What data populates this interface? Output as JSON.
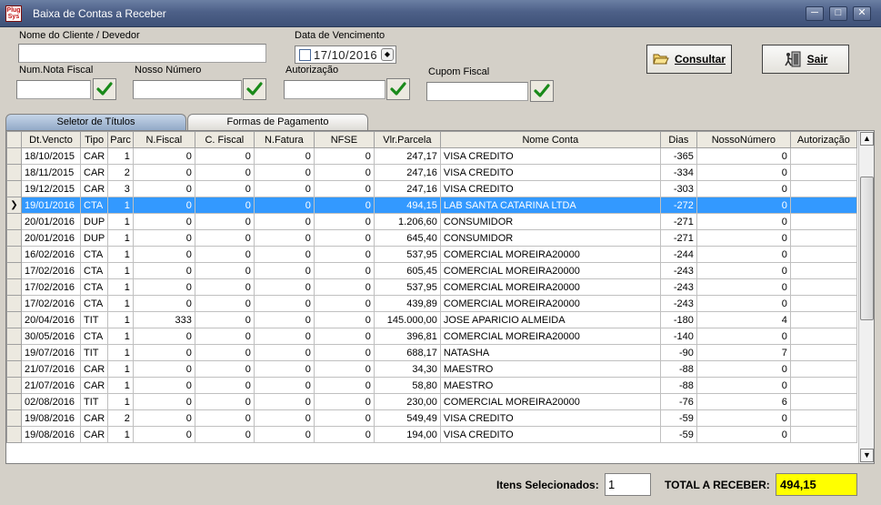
{
  "window": {
    "title": "Baixa de Contas a Receber",
    "app_icon_text": "Plug Sys"
  },
  "form": {
    "cliente_label": "Nome do Cliente / Devedor",
    "cliente_value": "",
    "vencimento_label": "Data de Vencimento",
    "vencimento_value": "17/10/2016",
    "num_nota_label": "Num.Nota Fiscal",
    "nosso_numero_label": "Nosso Número",
    "autorizacao_label": "Autorização",
    "cupom_label": "Cupom Fiscal",
    "consultar_label": "Consultar",
    "sair_label": "Sair"
  },
  "tabs": [
    {
      "label": "Seletor de Títulos",
      "active": true
    },
    {
      "label": "Formas de Pagamento",
      "active": false
    }
  ],
  "grid": {
    "columns": [
      "Dt.Vencto",
      "Tipo",
      "Parc",
      "N.Fiscal",
      "C. Fiscal",
      "N.Fatura",
      "NFSE",
      "Vlr.Parcela",
      "Nome Conta",
      "Dias",
      "NossoNúmero",
      "Autorização"
    ],
    "rows": [
      [
        "18/10/2015",
        "CAR",
        "1",
        "0",
        "0",
        "0",
        "0",
        "247,17",
        "VISA CREDITO",
        "-365",
        "0",
        ""
      ],
      [
        "18/11/2015",
        "CAR",
        "2",
        "0",
        "0",
        "0",
        "0",
        "247,16",
        "VISA CREDITO",
        "-334",
        "0",
        ""
      ],
      [
        "19/12/2015",
        "CAR",
        "3",
        "0",
        "0",
        "0",
        "0",
        "247,16",
        "VISA CREDITO",
        "-303",
        "0",
        ""
      ],
      [
        "19/01/2016",
        "CTA",
        "1",
        "0",
        "0",
        "0",
        "0",
        "494,15",
        "LAB SANTA CATARINA LTDA",
        "-272",
        "0",
        ""
      ],
      [
        "20/01/2016",
        "DUP",
        "1",
        "0",
        "0",
        "0",
        "0",
        "1.206,60",
        "CONSUMIDOR",
        "-271",
        "0",
        ""
      ],
      [
        "20/01/2016",
        "DUP",
        "1",
        "0",
        "0",
        "0",
        "0",
        "645,40",
        "CONSUMIDOR",
        "-271",
        "0",
        ""
      ],
      [
        "16/02/2016",
        "CTA",
        "1",
        "0",
        "0",
        "0",
        "0",
        "537,95",
        "COMERCIAL MOREIRA20000",
        "-244",
        "0",
        ""
      ],
      [
        "17/02/2016",
        "CTA",
        "1",
        "0",
        "0",
        "0",
        "0",
        "605,45",
        "COMERCIAL MOREIRA20000",
        "-243",
        "0",
        ""
      ],
      [
        "17/02/2016",
        "CTA",
        "1",
        "0",
        "0",
        "0",
        "0",
        "537,95",
        "COMERCIAL MOREIRA20000",
        "-243",
        "0",
        ""
      ],
      [
        "17/02/2016",
        "CTA",
        "1",
        "0",
        "0",
        "0",
        "0",
        "439,89",
        "COMERCIAL MOREIRA20000",
        "-243",
        "0",
        ""
      ],
      [
        "20/04/2016",
        "TIT",
        "1",
        "333",
        "0",
        "0",
        "0",
        "145.000,00",
        "JOSE APARICIO ALMEIDA",
        "-180",
        "4",
        ""
      ],
      [
        "30/05/2016",
        "CTA",
        "1",
        "0",
        "0",
        "0",
        "0",
        "396,81",
        "COMERCIAL MOREIRA20000",
        "-140",
        "0",
        ""
      ],
      [
        "19/07/2016",
        "TIT",
        "1",
        "0",
        "0",
        "0",
        "0",
        "688,17",
        "NATASHA",
        "-90",
        "7",
        ""
      ],
      [
        "21/07/2016",
        "CAR",
        "1",
        "0",
        "0",
        "0",
        "0",
        "34,30",
        "MAESTRO",
        "-88",
        "0",
        ""
      ],
      [
        "21/07/2016",
        "CAR",
        "1",
        "0",
        "0",
        "0",
        "0",
        "58,80",
        "MAESTRO",
        "-88",
        "0",
        ""
      ],
      [
        "02/08/2016",
        "TIT",
        "1",
        "0",
        "0",
        "0",
        "0",
        "230,00",
        "COMERCIAL MOREIRA20000",
        "-76",
        "6",
        ""
      ],
      [
        "19/08/2016",
        "CAR",
        "2",
        "0",
        "0",
        "0",
        "0",
        "549,49",
        "VISA CREDITO",
        "-59",
        "0",
        ""
      ],
      [
        "19/08/2016",
        "CAR",
        "1",
        "0",
        "0",
        "0",
        "0",
        "194,00",
        "VISA CREDITO",
        "-59",
        "0",
        ""
      ]
    ],
    "selected_row": 3
  },
  "footer": {
    "itens_label": "Itens Selecionados:",
    "itens_value": "1",
    "total_label": "TOTAL A RECEBER:",
    "total_value": "494,15"
  },
  "colors": {
    "selection": "#3399ff",
    "total_highlight": "#ffff00",
    "titlebar": "#4d6088"
  }
}
